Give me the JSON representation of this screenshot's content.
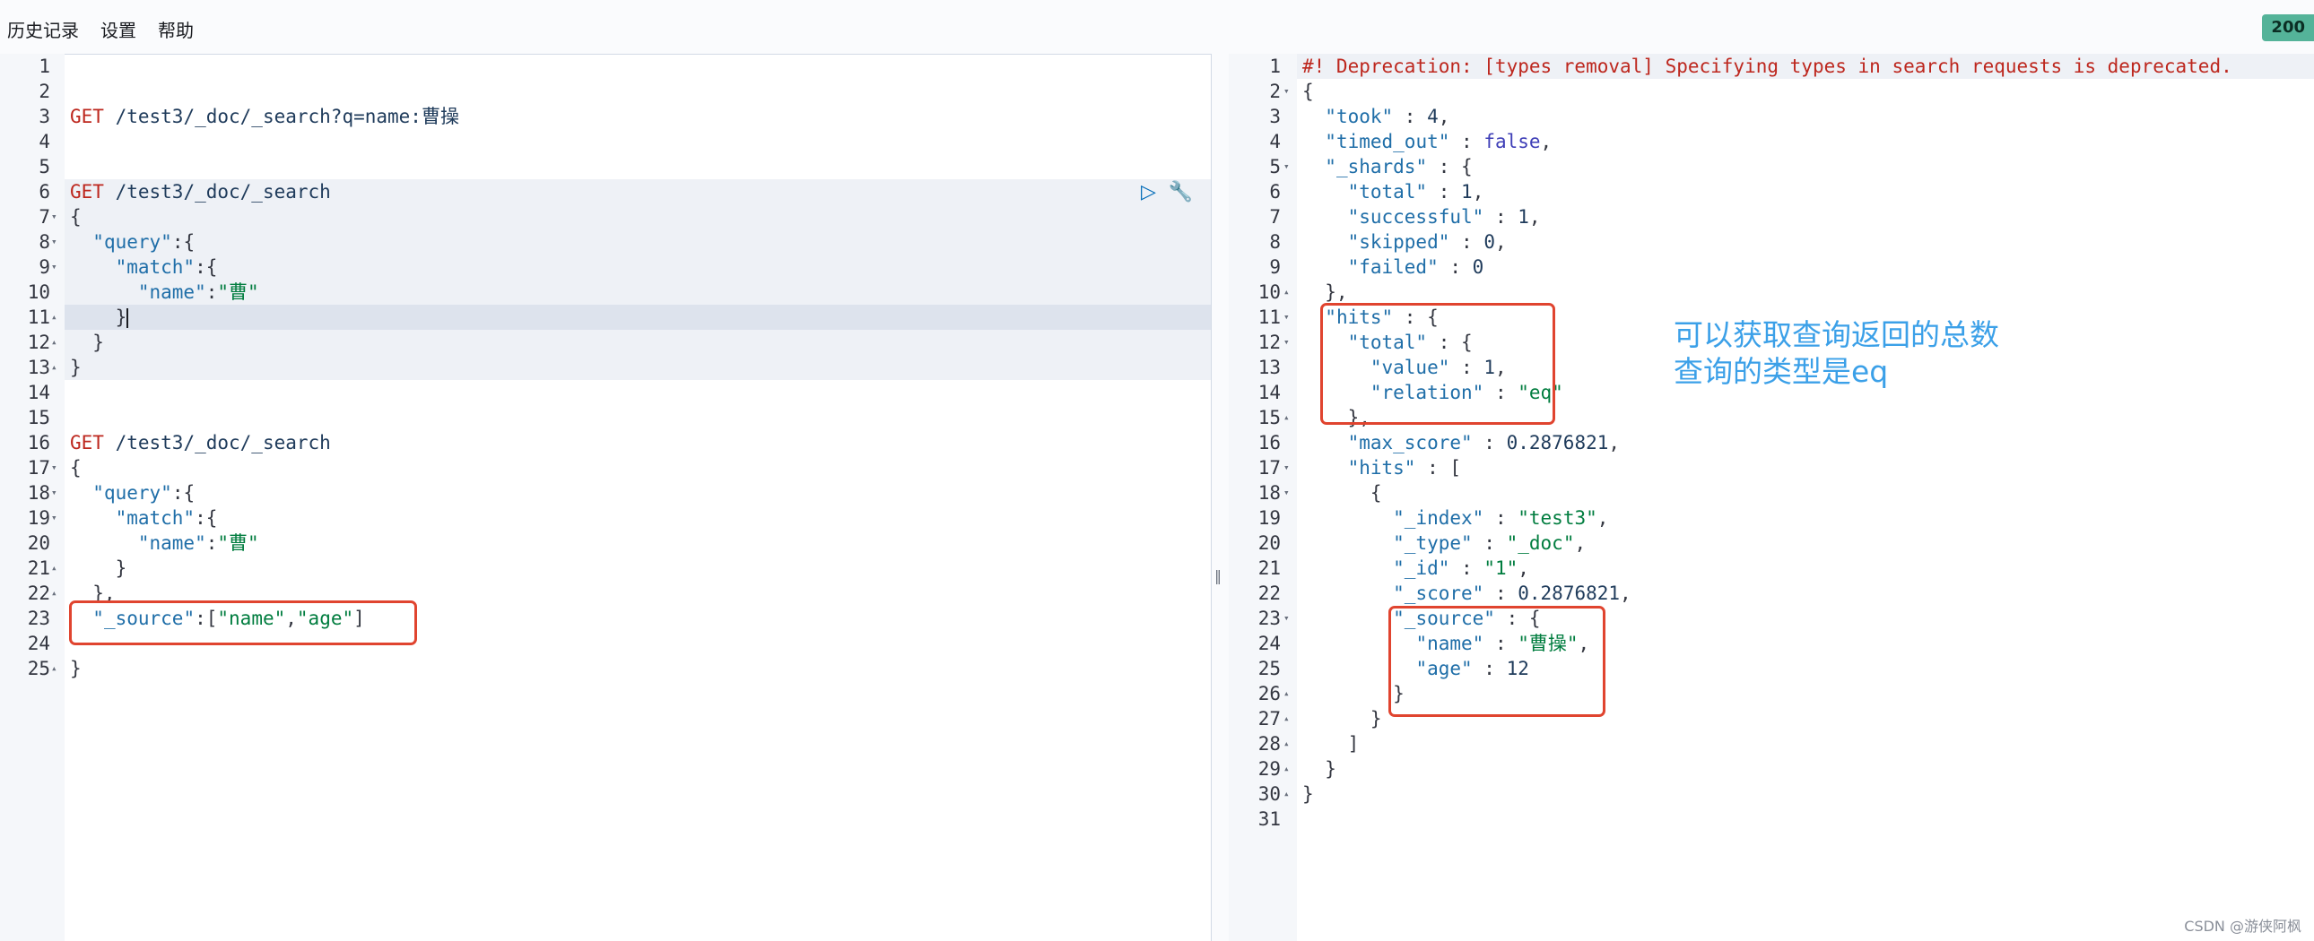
{
  "menu": {
    "history": "历史记录",
    "settings": "设置",
    "help": "帮助"
  },
  "status_code": "200",
  "request_lines": [
    {
      "n": "1",
      "fold": "",
      "parts": []
    },
    {
      "n": "2",
      "fold": "",
      "parts": []
    },
    {
      "n": "3",
      "fold": "",
      "parts": [
        [
          "k-method",
          "GET"
        ],
        [
          "k-url",
          " /test3/_doc/_search?q=name:曹操"
        ]
      ]
    },
    {
      "n": "4",
      "fold": "",
      "parts": []
    },
    {
      "n": "5",
      "fold": "",
      "parts": []
    },
    {
      "n": "6",
      "fold": "",
      "parts": [
        [
          "k-method",
          "GET"
        ],
        [
          "k-url",
          " /test3/_doc/_search"
        ]
      ]
    },
    {
      "n": "7",
      "fold": "▾",
      "parts": [
        [
          "k-punc",
          "{"
        ]
      ]
    },
    {
      "n": "8",
      "fold": "▾",
      "parts": [
        [
          "k-punc",
          "  "
        ],
        [
          "k-key",
          "\"query\""
        ],
        [
          "k-punc",
          ":{"
        ]
      ]
    },
    {
      "n": "9",
      "fold": "▾",
      "parts": [
        [
          "k-punc",
          "    "
        ],
        [
          "k-key",
          "\"match\""
        ],
        [
          "k-punc",
          ":{"
        ]
      ]
    },
    {
      "n": "10",
      "fold": "",
      "parts": [
        [
          "k-punc",
          "      "
        ],
        [
          "k-key",
          "\"name\""
        ],
        [
          "k-punc",
          ":"
        ],
        [
          "k-str",
          "\"曹\""
        ]
      ]
    },
    {
      "n": "11",
      "fold": "▴",
      "parts": [
        [
          "k-punc",
          "    }"
        ]
      ],
      "cursor": true
    },
    {
      "n": "12",
      "fold": "▴",
      "parts": [
        [
          "k-punc",
          "  }"
        ]
      ]
    },
    {
      "n": "13",
      "fold": "▴",
      "parts": [
        [
          "k-punc",
          "}"
        ]
      ]
    },
    {
      "n": "14",
      "fold": "",
      "parts": []
    },
    {
      "n": "15",
      "fold": "",
      "parts": []
    },
    {
      "n": "16",
      "fold": "",
      "parts": [
        [
          "k-method",
          "GET"
        ],
        [
          "k-url",
          " /test3/_doc/_search"
        ]
      ]
    },
    {
      "n": "17",
      "fold": "▾",
      "parts": [
        [
          "k-punc",
          "{"
        ]
      ]
    },
    {
      "n": "18",
      "fold": "▾",
      "parts": [
        [
          "k-punc",
          "  "
        ],
        [
          "k-key",
          "\"query\""
        ],
        [
          "k-punc",
          ":{"
        ]
      ]
    },
    {
      "n": "19",
      "fold": "▾",
      "parts": [
        [
          "k-punc",
          "    "
        ],
        [
          "k-key",
          "\"match\""
        ],
        [
          "k-punc",
          ":{"
        ]
      ]
    },
    {
      "n": "20",
      "fold": "",
      "parts": [
        [
          "k-punc",
          "      "
        ],
        [
          "k-key",
          "\"name\""
        ],
        [
          "k-punc",
          ":"
        ],
        [
          "k-str",
          "\"曹\""
        ]
      ]
    },
    {
      "n": "21",
      "fold": "▴",
      "parts": [
        [
          "k-punc",
          "    }"
        ]
      ]
    },
    {
      "n": "22",
      "fold": "▴",
      "parts": [
        [
          "k-punc",
          "  },"
        ]
      ]
    },
    {
      "n": "23",
      "fold": "",
      "parts": [
        [
          "k-punc",
          "  "
        ],
        [
          "k-key",
          "\"_source\""
        ],
        [
          "k-punc",
          ":["
        ],
        [
          "k-str",
          "\"name\""
        ],
        [
          "k-punc",
          ","
        ],
        [
          "k-str",
          "\"age\""
        ],
        [
          "k-punc",
          "]"
        ]
      ]
    },
    {
      "n": "24",
      "fold": "",
      "parts": []
    },
    {
      "n": "25",
      "fold": "▴",
      "parts": [
        [
          "k-punc",
          "}"
        ]
      ]
    }
  ],
  "response_lines": [
    {
      "n": "1",
      "fold": "",
      "parts": [
        [
          "k-comment",
          "#! Deprecation: [types removal] Specifying types in search requests is deprecated."
        ]
      ]
    },
    {
      "n": "2",
      "fold": "▾",
      "parts": [
        [
          "k-punc",
          "{"
        ]
      ]
    },
    {
      "n": "3",
      "fold": "",
      "parts": [
        [
          "k-punc",
          "  "
        ],
        [
          "k-key",
          "\"took\""
        ],
        [
          "k-punc",
          " : "
        ],
        [
          "k-num",
          "4"
        ],
        [
          "k-punc",
          ","
        ]
      ]
    },
    {
      "n": "4",
      "fold": "",
      "parts": [
        [
          "k-punc",
          "  "
        ],
        [
          "k-key",
          "\"timed_out\""
        ],
        [
          "k-punc",
          " : "
        ],
        [
          "k-bool",
          "false"
        ],
        [
          "k-punc",
          ","
        ]
      ]
    },
    {
      "n": "5",
      "fold": "▾",
      "parts": [
        [
          "k-punc",
          "  "
        ],
        [
          "k-key",
          "\"_shards\""
        ],
        [
          "k-punc",
          " : {"
        ]
      ]
    },
    {
      "n": "6",
      "fold": "",
      "parts": [
        [
          "k-punc",
          "    "
        ],
        [
          "k-key",
          "\"total\""
        ],
        [
          "k-punc",
          " : "
        ],
        [
          "k-num",
          "1"
        ],
        [
          "k-punc",
          ","
        ]
      ]
    },
    {
      "n": "7",
      "fold": "",
      "parts": [
        [
          "k-punc",
          "    "
        ],
        [
          "k-key",
          "\"successful\""
        ],
        [
          "k-punc",
          " : "
        ],
        [
          "k-num",
          "1"
        ],
        [
          "k-punc",
          ","
        ]
      ]
    },
    {
      "n": "8",
      "fold": "",
      "parts": [
        [
          "k-punc",
          "    "
        ],
        [
          "k-key",
          "\"skipped\""
        ],
        [
          "k-punc",
          " : "
        ],
        [
          "k-num",
          "0"
        ],
        [
          "k-punc",
          ","
        ]
      ]
    },
    {
      "n": "9",
      "fold": "",
      "parts": [
        [
          "k-punc",
          "    "
        ],
        [
          "k-key",
          "\"failed\""
        ],
        [
          "k-punc",
          " : "
        ],
        [
          "k-num",
          "0"
        ]
      ]
    },
    {
      "n": "10",
      "fold": "▴",
      "parts": [
        [
          "k-punc",
          "  },"
        ]
      ]
    },
    {
      "n": "11",
      "fold": "▾",
      "parts": [
        [
          "k-punc",
          "  "
        ],
        [
          "k-key",
          "\"hits\""
        ],
        [
          "k-punc",
          " : {"
        ]
      ]
    },
    {
      "n": "12",
      "fold": "▾",
      "parts": [
        [
          "k-punc",
          "    "
        ],
        [
          "k-key",
          "\"total\""
        ],
        [
          "k-punc",
          " : {"
        ]
      ]
    },
    {
      "n": "13",
      "fold": "",
      "parts": [
        [
          "k-punc",
          "      "
        ],
        [
          "k-key",
          "\"value\""
        ],
        [
          "k-punc",
          " : "
        ],
        [
          "k-num",
          "1"
        ],
        [
          "k-punc",
          ","
        ]
      ]
    },
    {
      "n": "14",
      "fold": "",
      "parts": [
        [
          "k-punc",
          "      "
        ],
        [
          "k-key",
          "\"relation\""
        ],
        [
          "k-punc",
          " : "
        ],
        [
          "k-str",
          "\"eq\""
        ]
      ]
    },
    {
      "n": "15",
      "fold": "▴",
      "parts": [
        [
          "k-punc",
          "    },"
        ]
      ]
    },
    {
      "n": "16",
      "fold": "",
      "parts": [
        [
          "k-punc",
          "    "
        ],
        [
          "k-key",
          "\"max_score\""
        ],
        [
          "k-punc",
          " : "
        ],
        [
          "k-num",
          "0.2876821"
        ],
        [
          "k-punc",
          ","
        ]
      ]
    },
    {
      "n": "17",
      "fold": "▾",
      "parts": [
        [
          "k-punc",
          "    "
        ],
        [
          "k-key",
          "\"hits\""
        ],
        [
          "k-punc",
          " : ["
        ]
      ]
    },
    {
      "n": "18",
      "fold": "▾",
      "parts": [
        [
          "k-punc",
          "      {"
        ]
      ]
    },
    {
      "n": "19",
      "fold": "",
      "parts": [
        [
          "k-punc",
          "        "
        ],
        [
          "k-key",
          "\"_index\""
        ],
        [
          "k-punc",
          " : "
        ],
        [
          "k-str",
          "\"test3\""
        ],
        [
          "k-punc",
          ","
        ]
      ]
    },
    {
      "n": "20",
      "fold": "",
      "parts": [
        [
          "k-punc",
          "        "
        ],
        [
          "k-key",
          "\"_type\""
        ],
        [
          "k-punc",
          " : "
        ],
        [
          "k-str",
          "\"_doc\""
        ],
        [
          "k-punc",
          ","
        ]
      ]
    },
    {
      "n": "21",
      "fold": "",
      "parts": [
        [
          "k-punc",
          "        "
        ],
        [
          "k-key",
          "\"_id\""
        ],
        [
          "k-punc",
          " : "
        ],
        [
          "k-str",
          "\"1\""
        ],
        [
          "k-punc",
          ","
        ]
      ]
    },
    {
      "n": "22",
      "fold": "",
      "parts": [
        [
          "k-punc",
          "        "
        ],
        [
          "k-key",
          "\"_score\""
        ],
        [
          "k-punc",
          " : "
        ],
        [
          "k-num",
          "0.2876821"
        ],
        [
          "k-punc",
          ","
        ]
      ]
    },
    {
      "n": "23",
      "fold": "▾",
      "parts": [
        [
          "k-punc",
          "        "
        ],
        [
          "k-key",
          "\"_source\""
        ],
        [
          "k-punc",
          " : {"
        ]
      ]
    },
    {
      "n": "24",
      "fold": "",
      "parts": [
        [
          "k-punc",
          "          "
        ],
        [
          "k-key",
          "\"name\""
        ],
        [
          "k-punc",
          " : "
        ],
        [
          "k-str",
          "\"曹操\""
        ],
        [
          "k-punc",
          ","
        ]
      ]
    },
    {
      "n": "25",
      "fold": "",
      "parts": [
        [
          "k-punc",
          "          "
        ],
        [
          "k-key",
          "\"age\""
        ],
        [
          "k-punc",
          " : "
        ],
        [
          "k-num",
          "12"
        ]
      ]
    },
    {
      "n": "26",
      "fold": "▴",
      "parts": [
        [
          "k-punc",
          "        }"
        ]
      ]
    },
    {
      "n": "27",
      "fold": "▴",
      "parts": [
        [
          "k-punc",
          "      }"
        ]
      ]
    },
    {
      "n": "28",
      "fold": "▴",
      "parts": [
        [
          "k-punc",
          "    ]"
        ]
      ]
    },
    {
      "n": "29",
      "fold": "▴",
      "parts": [
        [
          "k-punc",
          "  }"
        ]
      ]
    },
    {
      "n": "30",
      "fold": "▴",
      "parts": [
        [
          "k-punc",
          "}"
        ]
      ]
    },
    {
      "n": "31",
      "fold": "",
      "parts": []
    }
  ],
  "annotation": {
    "line1": "可以获取查询返回的总数",
    "line2": "查询的类型是eq"
  },
  "watermark": "CSDN @游侠阿枫",
  "icons": {
    "run": "play-icon",
    "settings": "wrench-icon",
    "divider": "resize-handle-icon"
  }
}
